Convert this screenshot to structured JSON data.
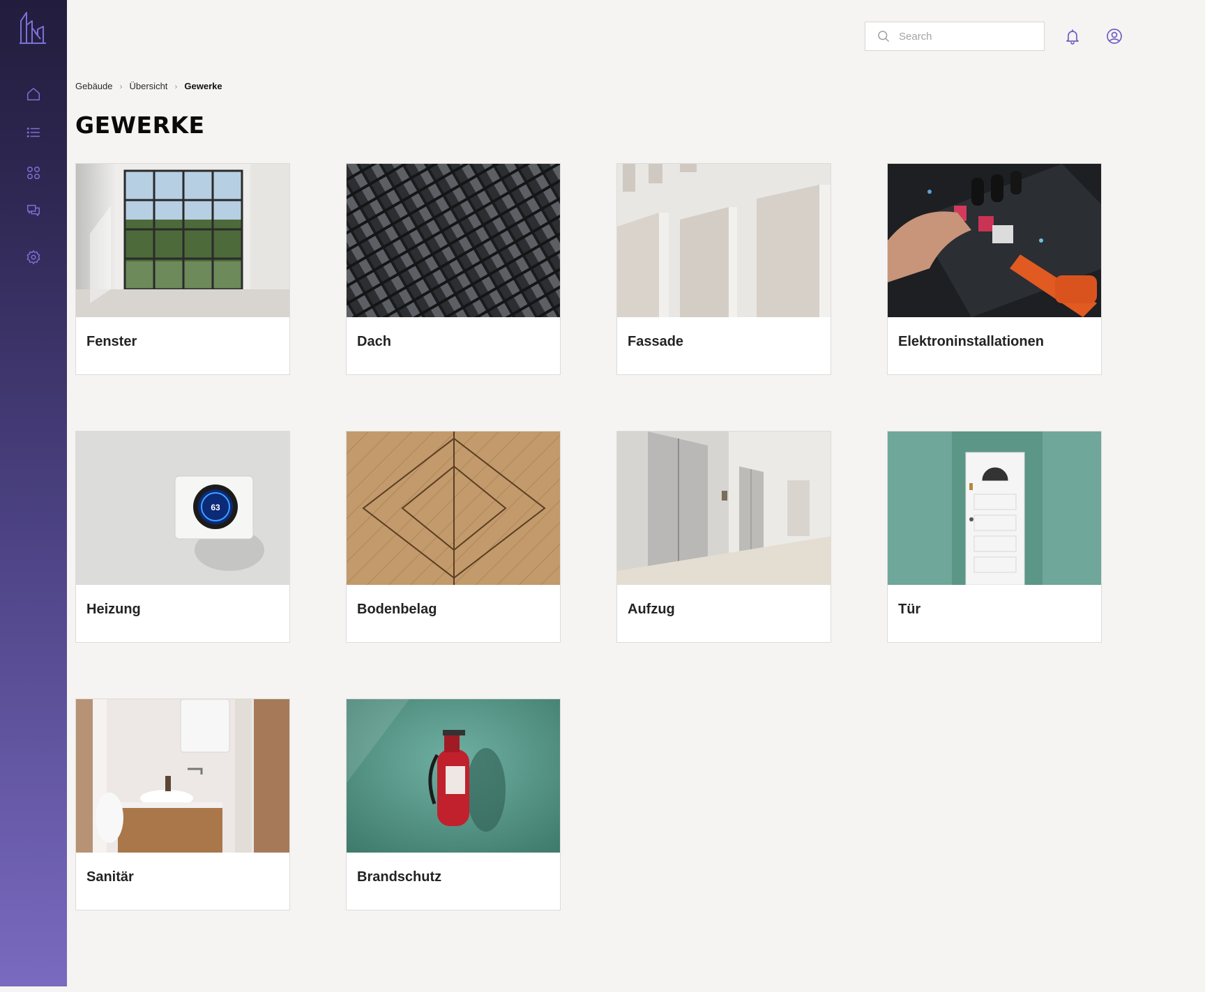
{
  "app": {
    "logo_icon": "building-logo-icon",
    "accent_color": "#6c5fc4"
  },
  "sidebar": {
    "items": [
      {
        "icon": "home-icon"
      },
      {
        "icon": "list-icon"
      },
      {
        "icon": "grid-icon"
      },
      {
        "icon": "chat-icon"
      },
      {
        "icon": "gear-icon"
      }
    ]
  },
  "header": {
    "search_placeholder": "Search",
    "notification_icon": "bell-icon",
    "profile_icon": "user-circle-icon"
  },
  "breadcrumb": {
    "items": [
      "Gebäude",
      "Übersicht",
      "Gewerke"
    ]
  },
  "page": {
    "title": "GEWERKE"
  },
  "cards": [
    {
      "label": "Fenster"
    },
    {
      "label": "Dach"
    },
    {
      "label": "Fassade"
    },
    {
      "label": "Elektroninstallationen"
    },
    {
      "label": "Heizung"
    },
    {
      "label": "Bodenbelag"
    },
    {
      "label": "Aufzug"
    },
    {
      "label": "Tür"
    },
    {
      "label": "Sanitär"
    },
    {
      "label": "Brandschutz"
    }
  ],
  "thermostat_reading": "63"
}
